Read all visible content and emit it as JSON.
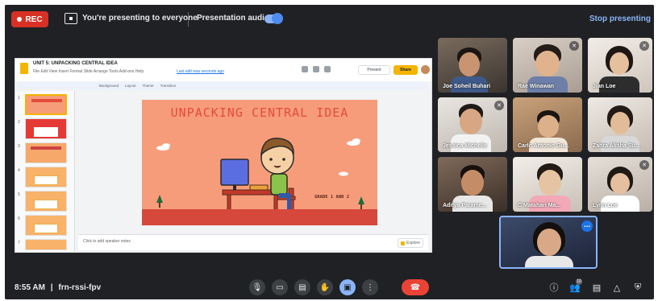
{
  "topbar": {
    "rec_label": "REC",
    "presenting_text": "You're presenting to everyone",
    "audio_label": "Presentation audio",
    "audio_enabled": true,
    "stop_label": "Stop presenting"
  },
  "slides_app": {
    "doc_title": "UNIT 5: UNPACKING CENTRAL IDEA",
    "menu": "File  Edit  View  Insert  Format  Slide  Arrange  Tools  Add-ons  Help",
    "last_edit": "Last edit was seconds ago",
    "present_label": "Present",
    "share_label": "Share",
    "toolbar": [
      "Background",
      "Layout",
      "Theme",
      "Transition"
    ],
    "thumb_numbers": [
      "1",
      "2",
      "3",
      "4",
      "5",
      "6",
      "7"
    ],
    "notes_placeholder": "Click to add speaker notes",
    "explore_label": "Explore",
    "slide": {
      "title": "UNPACKING CENTRAL IDEA",
      "grade": "GRADE 1 AND 2"
    }
  },
  "participants": [
    {
      "name": "Joe Soheil Buhari",
      "muted": false
    },
    {
      "name": "Rae Winawan",
      "muted": true
    },
    {
      "name": "Jian Loe",
      "muted": true
    },
    {
      "name": "Jessica Michelle",
      "muted": true
    },
    {
      "name": "Carlo Antonio Gu...",
      "muted": false
    },
    {
      "name": "Zahra Alisha Su...",
      "muted": false
    },
    {
      "name": "Aditya Parame...",
      "muted": false
    },
    {
      "name": "C Matahari Ma...",
      "muted": false
    },
    {
      "name": "Lynn Loe",
      "muted": true
    }
  ],
  "self_more_icon": "more-vert-icon",
  "bottombar": {
    "time": "8:55 AM",
    "separator": "|",
    "meeting_code": "frn-rssi-fpv",
    "people_count": "10"
  },
  "colors": {
    "meet_bg": "#202124",
    "rec_red": "#d93025",
    "accent_blue": "#8ab4f8",
    "end_call": "#ea4335",
    "slide_bg": "#f79c7a",
    "slide_title": "#e24d3b"
  }
}
